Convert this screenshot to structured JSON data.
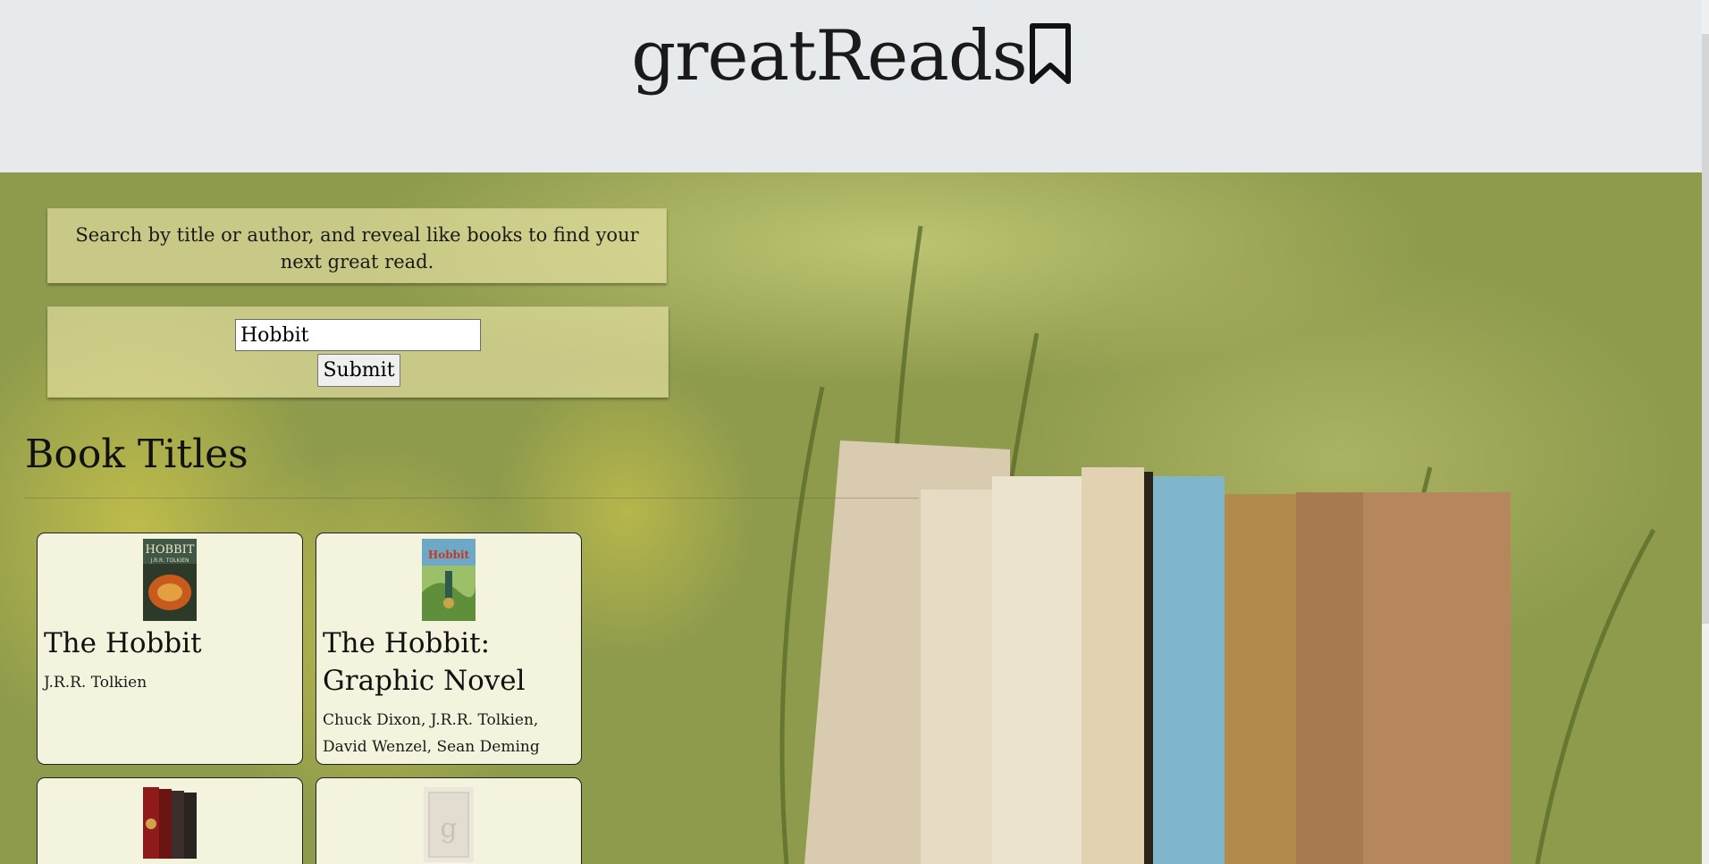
{
  "app": {
    "title": "greatReads"
  },
  "intro": {
    "text": "Search by title or author, and reveal like books to find your next great read."
  },
  "search": {
    "value": "Hobbit",
    "submit_label": "Submit"
  },
  "results": {
    "heading": "Book Titles",
    "books": [
      {
        "title": "The Hobbit",
        "authors": "J.R.R. Tolkien"
      },
      {
        "title": "The Hobbit: Graphic Novel",
        "authors": "Chuck Dixon, J.R.R. Tolkien, David Wenzel, Sean Deming"
      },
      {
        "title": "",
        "authors": ""
      },
      {
        "title": "",
        "authors": ""
      }
    ]
  },
  "icons": {
    "logo_icon": "bookmark-icon",
    "placeholder_cover_letter": "g"
  },
  "colors": {
    "header_bg": "#e7eaed",
    "card_bg": "#f4f3de",
    "panel_bg": "#ece6aa"
  }
}
